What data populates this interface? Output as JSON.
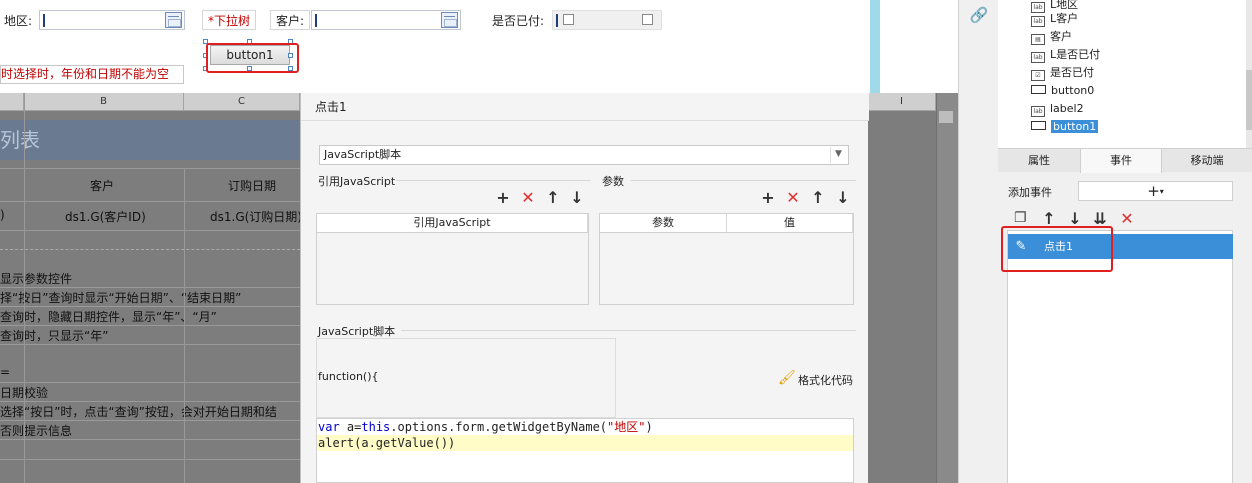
{
  "designer": {
    "region_label": "地区:",
    "dropdown_tree_label": "*下拉树",
    "customer_label": "客户:",
    "paid_label": "是否已付:",
    "button_label": "button1",
    "message_text": "时选择时，年份和日期不能为空"
  },
  "sheet": {
    "columns": [
      "B",
      "C",
      "I"
    ],
    "banner_text": "列表",
    "header_customer": "客户",
    "header_order_date": "订购日期",
    "cell_left": ")",
    "cell_customer": "ds1.G(客户ID)",
    "cell_order_date": "ds1.G(订购日期)",
    "notes": [
      "显示参数控件",
      "择“按日”查询时显示“开始日期”、“结束日期”",
      "查询时，隐藏日期控件，显示“年”、“月”",
      "查询时，只显示“年”",
      "=",
      "日期校验",
      "选择“按日”时，点击“查询”按钮，会对开始日期和结",
      "否则提示信息"
    ]
  },
  "dialog": {
    "title": "点击1",
    "script_type": "JavaScript脚本",
    "ref_js_group": "引用JavaScript",
    "params_group": "参数",
    "ref_js_col": "引用JavaScript",
    "param_col": "参数",
    "value_col": "值",
    "script_group": "JavaScript脚本",
    "function_header": "function(){",
    "format_code": "格式化代码",
    "code_line1_kw1": "var",
    "code_line1_mid1": " a=",
    "code_line1_kw2": "this",
    "code_line1_mid2": ".options.form.getWidgetByName(",
    "code_line1_str": "\"地区\"",
    "code_line1_end": ")",
    "code_line2": "alert(a.getValue())"
  },
  "right_panel": {
    "tree_items": [
      {
        "type": "label",
        "text": "L地区"
      },
      {
        "type": "label",
        "text": "L客户"
      },
      {
        "type": "label",
        "text": "客户"
      },
      {
        "type": "label",
        "text": "L是否已付"
      },
      {
        "type": "checkbox",
        "text": "是否已付"
      },
      {
        "type": "button",
        "text": "button0"
      },
      {
        "type": "label",
        "text": "label2"
      },
      {
        "type": "button",
        "text": "button1"
      }
    ],
    "tabs": [
      "属性",
      "事件",
      "移动端"
    ],
    "add_event_label": "添加事件",
    "add_symbol": "+",
    "event_item": "点击1"
  },
  "icons": {
    "accent_blue": "#3b8fd8",
    "red_highlight": "#e02020"
  }
}
